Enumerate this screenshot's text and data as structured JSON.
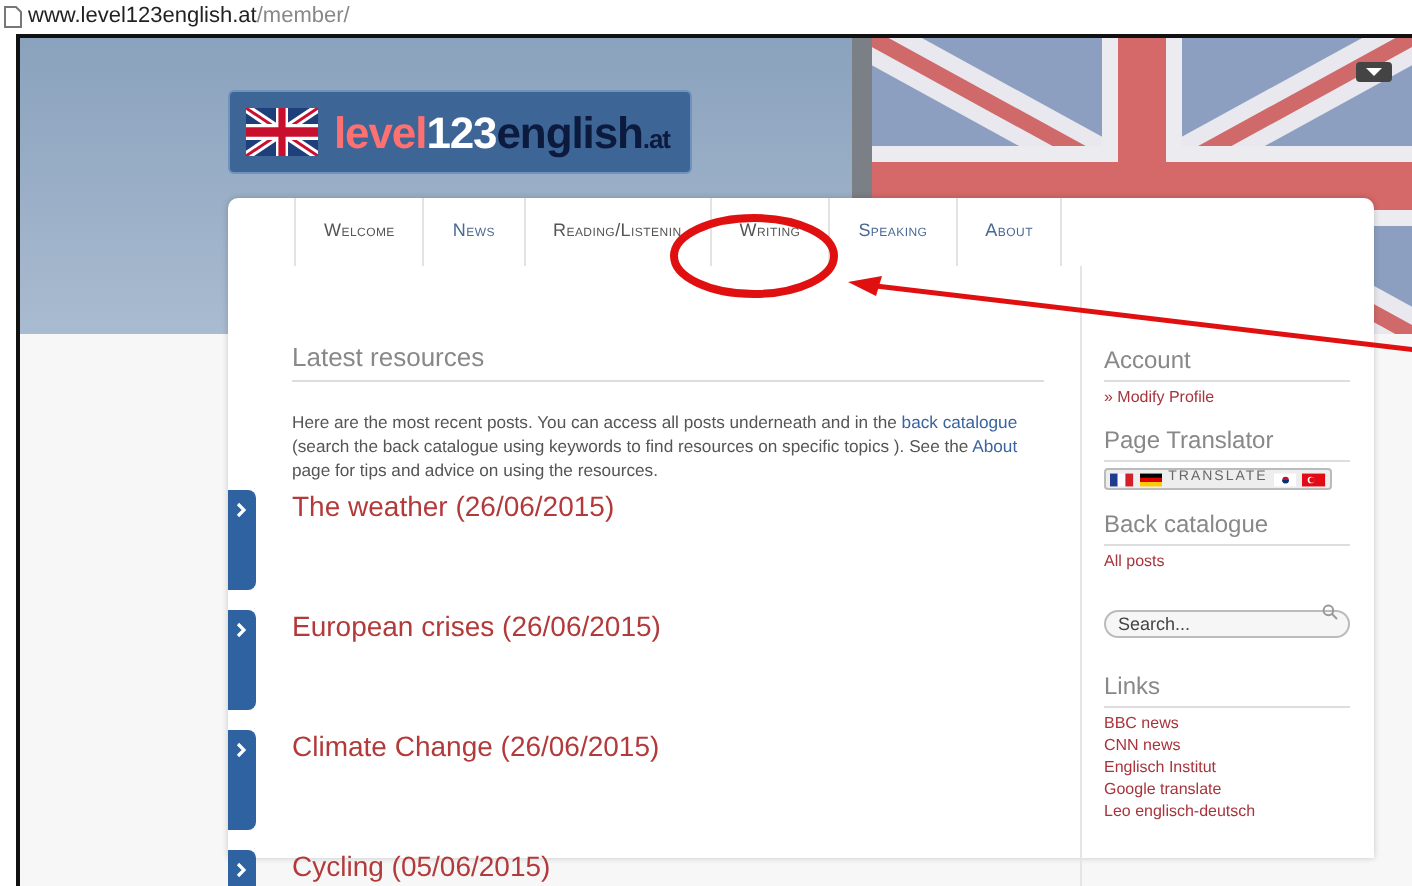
{
  "address_bar": {
    "host": "www.level123english.at",
    "path": "/member/"
  },
  "logo": [
    "level",
    "123",
    "english",
    ".at"
  ],
  "nav": [
    {
      "label": "Welcome",
      "visited": true
    },
    {
      "label": "News",
      "visited": false
    },
    {
      "label": "Reading/Listenin",
      "visited": true
    },
    {
      "label": "Writing",
      "visited": true
    },
    {
      "label": "Speaking",
      "visited": false
    },
    {
      "label": "About",
      "visited": false
    }
  ],
  "main": {
    "heading": "Latest resources",
    "intro": [
      "Here are the most recent posts. You can access all posts underneath and in the ",
      "back catalogue",
      " (search the back catalogue using keywords to find resources on specific topics ). See the ",
      "About",
      " page for tips and advice on using the resources."
    ],
    "posts": [
      "The weather (26/06/2015)",
      "European crises (26/06/2015)",
      "Climate Change (26/06/2015)",
      "Cycling (05/06/2015)"
    ]
  },
  "sidebar": {
    "account": {
      "heading": "Account",
      "link": "» Modify Profile"
    },
    "translator": {
      "heading": "Page Translator",
      "button": "TRANSLATE"
    },
    "catalogue": {
      "heading": "Back catalogue",
      "link": "All posts"
    },
    "search": {
      "placeholder": "Search..."
    },
    "links": {
      "heading": "Links",
      "items": [
        "BBC news",
        "CNN news",
        "Englisch Institut",
        "Google translate",
        "Leo englisch-deutsch"
      ]
    }
  }
}
